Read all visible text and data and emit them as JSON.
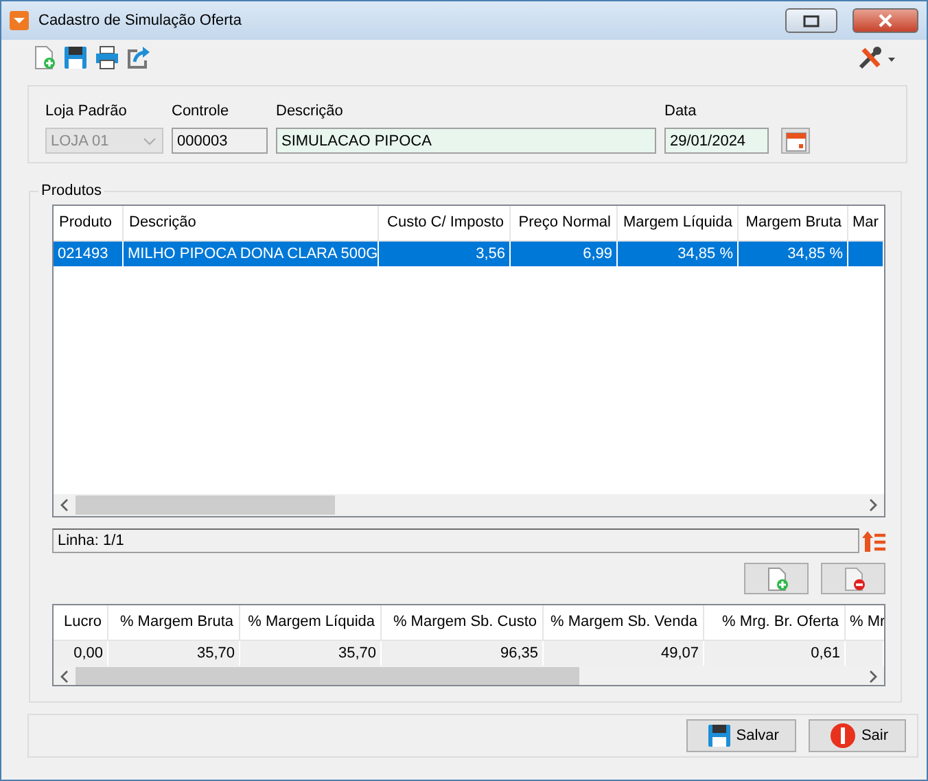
{
  "window": {
    "title": "Cadastro de Simulação Oferta"
  },
  "fields": [
    {
      "label": "Loja Padrão",
      "value": "LOJA 01",
      "kind": "select",
      "disabled": true
    },
    {
      "label": "Controle",
      "value": "000003",
      "kind": "readonly",
      "disabled": false
    },
    {
      "label": "Descrição",
      "value": "SIMULACAO PIPOCA",
      "kind": "text",
      "disabled": false
    },
    {
      "label": "Data",
      "value": "29/01/2024",
      "kind": "date",
      "disabled": false
    }
  ],
  "products": {
    "title": "Produtos",
    "columns": [
      {
        "label": "Produto"
      },
      {
        "label": "Descrição"
      },
      {
        "label": "Custo C/ Imposto"
      },
      {
        "label": "Preço Normal"
      },
      {
        "label": "Margem Líquida"
      },
      {
        "label": "Margem Bruta"
      },
      {
        "label": "Mar"
      }
    ],
    "rows": [
      {
        "selected": true,
        "cells": [
          "021493",
          "MILHO PIPOCA DONA CLARA 500G",
          "3,56",
          "6,99",
          "34,85 %",
          "34,85 %",
          ""
        ]
      }
    ],
    "status": "Linha: 1/1"
  },
  "summary": {
    "columns": [
      {
        "label": "Lucro"
      },
      {
        "label": "% Margem Bruta"
      },
      {
        "label": "% Margem Líquida"
      },
      {
        "label": "% Margem Sb. Custo"
      },
      {
        "label": "% Margem Sb. Venda"
      },
      {
        "label": "% Mrg. Br. Oferta"
      },
      {
        "label": "% Mr"
      }
    ],
    "rows": [
      {
        "selected": false,
        "cells": [
          "0,00",
          "35,70",
          "35,70",
          "96,35",
          "49,07",
          "0,61",
          ""
        ]
      }
    ]
  },
  "buttons": [
    {
      "label": "Salvar",
      "kind": "save"
    },
    {
      "label": "Sair",
      "kind": "exit"
    }
  ]
}
